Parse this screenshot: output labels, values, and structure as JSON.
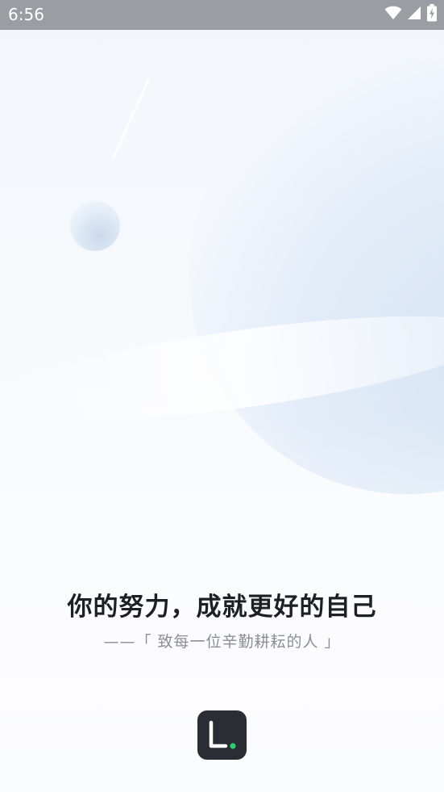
{
  "status_bar": {
    "time": "6:56",
    "icons": [
      "wifi-icon",
      "cellular-signal-icon",
      "battery-charging-icon"
    ]
  },
  "splash": {
    "slogan": "你的努力，成就更好的自己",
    "dedication": "——「 致每一位辛勤耕耘的人 」"
  },
  "app_logo": {
    "icon": "app-logo-icon",
    "accent_color": "#2ecc71",
    "background_color": "#2a2d34"
  },
  "colors": {
    "status_bar": "#9a9ea3",
    "planet": "#dbe7f6",
    "slogan_text": "#1e1f24",
    "dedication_text": "#8a8e95"
  }
}
